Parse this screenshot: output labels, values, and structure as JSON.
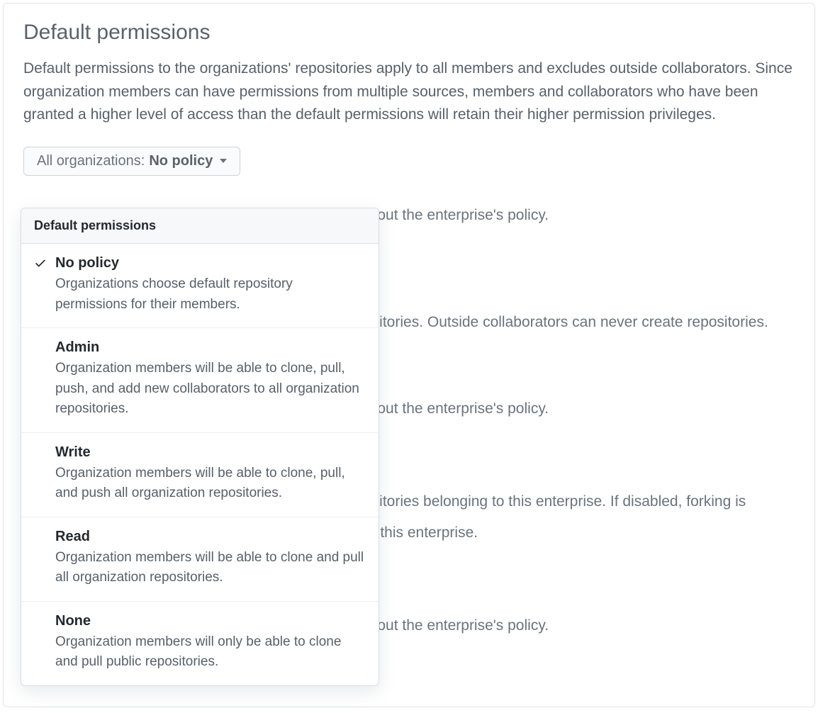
{
  "title": "Default permissions",
  "description": "Default permissions to the organizations' repositories apply to all members and excludes outside collaborators. Since organization members can have permissions from multiple sources, members and collaborators who have been granted a higher level of access than the default permissions will retain their higher permission privileges.",
  "dropdown": {
    "prefix": "All organizations: ",
    "value": "No policy"
  },
  "bg_texts": {
    "line1": "without the enterprise's policy.",
    "line2": "ositories. Outside collaborators can never create repositories.",
    "line3": "without the enterprise's policy.",
    "line4a": "ositories belonging to this enterprise. If disabled, forking is",
    "line4b": "to this enterprise.",
    "line5": "without the enterprise's policy."
  },
  "menu": {
    "header": "Default permissions",
    "options": [
      {
        "title": "No policy",
        "desc": "Organizations choose default repository permissions for their members.",
        "selected": true
      },
      {
        "title": "Admin",
        "desc": "Organization members will be able to clone, pull, push, and add new collaborators to all organization repositories.",
        "selected": false
      },
      {
        "title": "Write",
        "desc": "Organization members will be able to clone, pull, and push all organization repositories.",
        "selected": false
      },
      {
        "title": "Read",
        "desc": "Organization members will be able to clone and pull all organization repositories.",
        "selected": false
      },
      {
        "title": "None",
        "desc": "Organization members will only be able to clone and pull public repositories.",
        "selected": false
      }
    ]
  }
}
